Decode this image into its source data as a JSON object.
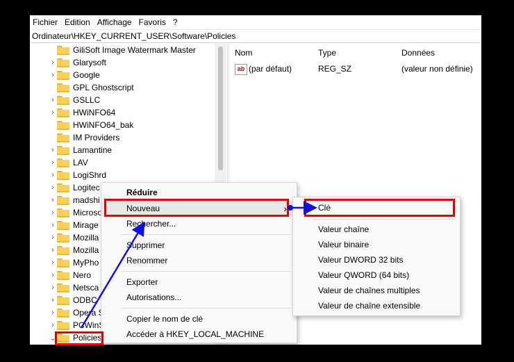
{
  "menubar": [
    "Fichier",
    "Edition",
    "Affichage",
    "Favoris",
    "?"
  ],
  "address": "Ordinateur\\HKEY_CURRENT_USER\\Software\\Policies",
  "tree": [
    {
      "label": "GiliSoft Image Watermark Master",
      "chev": ""
    },
    {
      "label": "Glarysoft",
      "chev": "›"
    },
    {
      "label": "Google",
      "chev": "›"
    },
    {
      "label": "GPL Ghostscript",
      "chev": ""
    },
    {
      "label": "GSLLC",
      "chev": "›"
    },
    {
      "label": "HWiNFO64",
      "chev": "›"
    },
    {
      "label": "HWiNFO64_bak",
      "chev": ""
    },
    {
      "label": "IM Providers",
      "chev": ""
    },
    {
      "label": "Lamantine",
      "chev": "›"
    },
    {
      "label": "LAV",
      "chev": "›"
    },
    {
      "label": "LogiShrd",
      "chev": "›"
    },
    {
      "label": "Logitec",
      "chev": "›"
    },
    {
      "label": "madshi",
      "chev": "›"
    },
    {
      "label": "Microso",
      "chev": "›"
    },
    {
      "label": "Mirage",
      "chev": "›"
    },
    {
      "label": "Mozilla",
      "chev": "›"
    },
    {
      "label": "Mozilla",
      "chev": "›"
    },
    {
      "label": "MyPho",
      "chev": "›"
    },
    {
      "label": "Nero",
      "chev": "›"
    },
    {
      "label": "Netsca",
      "chev": "›"
    },
    {
      "label": "ODBC",
      "chev": "›"
    },
    {
      "label": "Opera S",
      "chev": "›"
    },
    {
      "label": "PCWinS",
      "chev": "›"
    },
    {
      "label": "Policies",
      "chev": "⌄"
    }
  ],
  "columns": {
    "name": "Nom",
    "type": "Type",
    "data": "Données"
  },
  "value_row": {
    "name": "(par défaut)",
    "type": "REG_SZ",
    "data": "(valeur non définie)",
    "icon": "ab"
  },
  "context_menu": {
    "reduire": "Réduire",
    "nouveau": "Nouveau",
    "nouveau_arrow": "›",
    "rechercher": "Rechercher...",
    "supprimer": "Supprimer",
    "renommer": "Renommer",
    "exporter": "Exporter",
    "autorisations": "Autorisations...",
    "copier": "Copier le nom de clé",
    "acceder": "Accéder à HKEY_LOCAL_MACHINE"
  },
  "submenu": {
    "cle": "Clé",
    "valeur_chaine": "Valeur chaîne",
    "valeur_binaire": "Valeur binaire",
    "dword": "Valeur DWORD 32 bits",
    "qword": "Valeur QWORD (64 bits)",
    "multi": "Valeur de chaînes multiples",
    "extensible": "Valeur de chaîne extensible"
  },
  "colors": {
    "annotation_red": "#e10000",
    "annotation_blue": "#1010e0",
    "folder": "#f8d05b"
  }
}
